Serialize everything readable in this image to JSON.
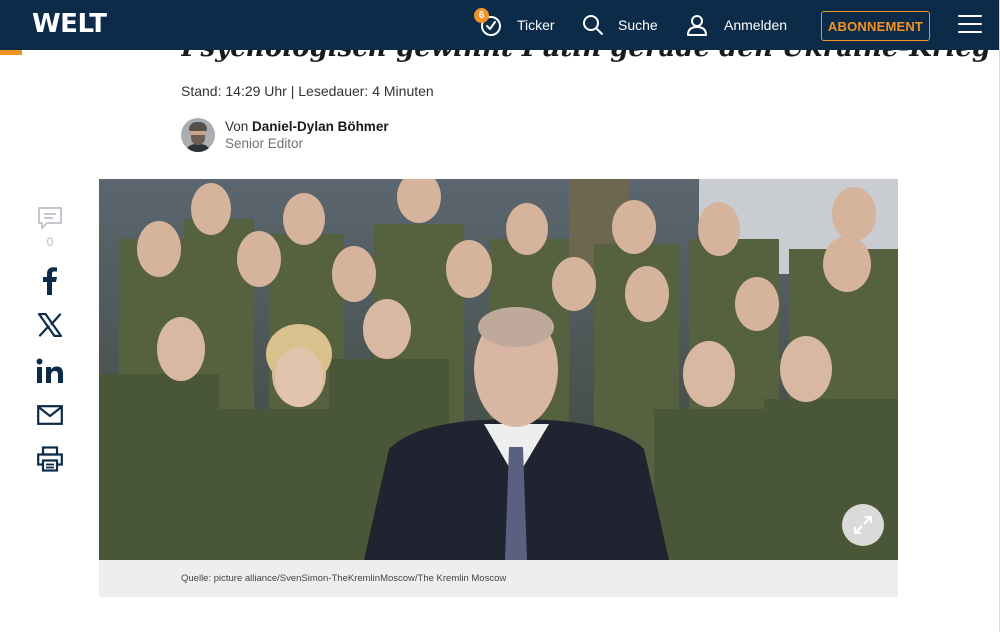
{
  "header": {
    "logo": "WELT",
    "ticker_label": "Ticker",
    "ticker_badge": "6",
    "search_label": "Suche",
    "login_label": "Anmelden",
    "subscribe_label": "ABONNEMENT"
  },
  "article": {
    "headline": "Psychologisch gewinnt Putin gerade den Ukraine-Krieg",
    "meta": "Stand: 14:29 Uhr | Lesedauer: 4 Minuten",
    "author_prefix": "Von",
    "author_name": "Daniel-Dylan Böhmer",
    "author_role": "Senior Editor"
  },
  "share": {
    "comment_count": "0",
    "items": [
      "comment-icon",
      "facebook-icon",
      "x-icon",
      "linkedin-icon",
      "mail-icon",
      "print-icon"
    ]
  },
  "photo": {
    "caption": "Quelle: picture alliance/SvenSimon-TheKremlinMoscow/The Kremlin Moscow"
  },
  "colors": {
    "header_bg": "#0b2b48",
    "accent": "#f39324",
    "icon_blue": "#0b2b48",
    "caption_bg": "#eeeeec"
  }
}
